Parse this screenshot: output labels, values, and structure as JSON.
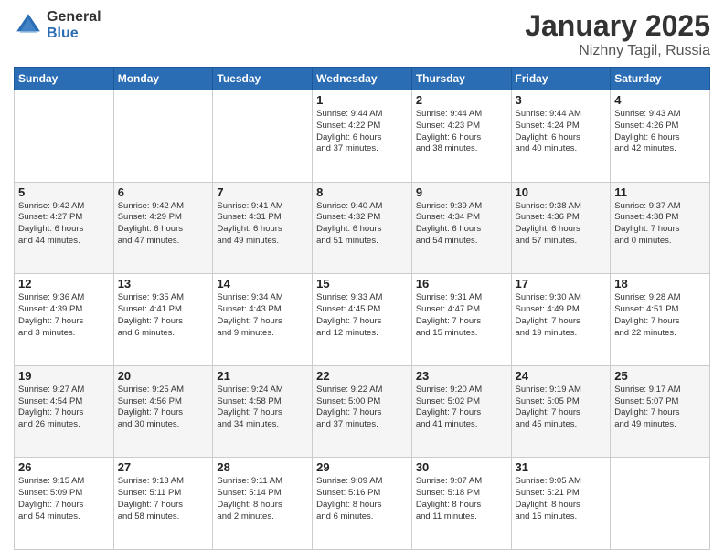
{
  "logo": {
    "general": "General",
    "blue": "Blue"
  },
  "header": {
    "month": "January 2025",
    "location": "Nizhny Tagil, Russia"
  },
  "weekdays": [
    "Sunday",
    "Monday",
    "Tuesday",
    "Wednesday",
    "Thursday",
    "Friday",
    "Saturday"
  ],
  "weeks": [
    [
      {
        "day": "",
        "info": ""
      },
      {
        "day": "",
        "info": ""
      },
      {
        "day": "",
        "info": ""
      },
      {
        "day": "1",
        "info": "Sunrise: 9:44 AM\nSunset: 4:22 PM\nDaylight: 6 hours\nand 37 minutes."
      },
      {
        "day": "2",
        "info": "Sunrise: 9:44 AM\nSunset: 4:23 PM\nDaylight: 6 hours\nand 38 minutes."
      },
      {
        "day": "3",
        "info": "Sunrise: 9:44 AM\nSunset: 4:24 PM\nDaylight: 6 hours\nand 40 minutes."
      },
      {
        "day": "4",
        "info": "Sunrise: 9:43 AM\nSunset: 4:26 PM\nDaylight: 6 hours\nand 42 minutes."
      }
    ],
    [
      {
        "day": "5",
        "info": "Sunrise: 9:42 AM\nSunset: 4:27 PM\nDaylight: 6 hours\nand 44 minutes."
      },
      {
        "day": "6",
        "info": "Sunrise: 9:42 AM\nSunset: 4:29 PM\nDaylight: 6 hours\nand 47 minutes."
      },
      {
        "day": "7",
        "info": "Sunrise: 9:41 AM\nSunset: 4:31 PM\nDaylight: 6 hours\nand 49 minutes."
      },
      {
        "day": "8",
        "info": "Sunrise: 9:40 AM\nSunset: 4:32 PM\nDaylight: 6 hours\nand 51 minutes."
      },
      {
        "day": "9",
        "info": "Sunrise: 9:39 AM\nSunset: 4:34 PM\nDaylight: 6 hours\nand 54 minutes."
      },
      {
        "day": "10",
        "info": "Sunrise: 9:38 AM\nSunset: 4:36 PM\nDaylight: 6 hours\nand 57 minutes."
      },
      {
        "day": "11",
        "info": "Sunrise: 9:37 AM\nSunset: 4:38 PM\nDaylight: 7 hours\nand 0 minutes."
      }
    ],
    [
      {
        "day": "12",
        "info": "Sunrise: 9:36 AM\nSunset: 4:39 PM\nDaylight: 7 hours\nand 3 minutes."
      },
      {
        "day": "13",
        "info": "Sunrise: 9:35 AM\nSunset: 4:41 PM\nDaylight: 7 hours\nand 6 minutes."
      },
      {
        "day": "14",
        "info": "Sunrise: 9:34 AM\nSunset: 4:43 PM\nDaylight: 7 hours\nand 9 minutes."
      },
      {
        "day": "15",
        "info": "Sunrise: 9:33 AM\nSunset: 4:45 PM\nDaylight: 7 hours\nand 12 minutes."
      },
      {
        "day": "16",
        "info": "Sunrise: 9:31 AM\nSunset: 4:47 PM\nDaylight: 7 hours\nand 15 minutes."
      },
      {
        "day": "17",
        "info": "Sunrise: 9:30 AM\nSunset: 4:49 PM\nDaylight: 7 hours\nand 19 minutes."
      },
      {
        "day": "18",
        "info": "Sunrise: 9:28 AM\nSunset: 4:51 PM\nDaylight: 7 hours\nand 22 minutes."
      }
    ],
    [
      {
        "day": "19",
        "info": "Sunrise: 9:27 AM\nSunset: 4:54 PM\nDaylight: 7 hours\nand 26 minutes."
      },
      {
        "day": "20",
        "info": "Sunrise: 9:25 AM\nSunset: 4:56 PM\nDaylight: 7 hours\nand 30 minutes."
      },
      {
        "day": "21",
        "info": "Sunrise: 9:24 AM\nSunset: 4:58 PM\nDaylight: 7 hours\nand 34 minutes."
      },
      {
        "day": "22",
        "info": "Sunrise: 9:22 AM\nSunset: 5:00 PM\nDaylight: 7 hours\nand 37 minutes."
      },
      {
        "day": "23",
        "info": "Sunrise: 9:20 AM\nSunset: 5:02 PM\nDaylight: 7 hours\nand 41 minutes."
      },
      {
        "day": "24",
        "info": "Sunrise: 9:19 AM\nSunset: 5:05 PM\nDaylight: 7 hours\nand 45 minutes."
      },
      {
        "day": "25",
        "info": "Sunrise: 9:17 AM\nSunset: 5:07 PM\nDaylight: 7 hours\nand 49 minutes."
      }
    ],
    [
      {
        "day": "26",
        "info": "Sunrise: 9:15 AM\nSunset: 5:09 PM\nDaylight: 7 hours\nand 54 minutes."
      },
      {
        "day": "27",
        "info": "Sunrise: 9:13 AM\nSunset: 5:11 PM\nDaylight: 7 hours\nand 58 minutes."
      },
      {
        "day": "28",
        "info": "Sunrise: 9:11 AM\nSunset: 5:14 PM\nDaylight: 8 hours\nand 2 minutes."
      },
      {
        "day": "29",
        "info": "Sunrise: 9:09 AM\nSunset: 5:16 PM\nDaylight: 8 hours\nand 6 minutes."
      },
      {
        "day": "30",
        "info": "Sunrise: 9:07 AM\nSunset: 5:18 PM\nDaylight: 8 hours\nand 11 minutes."
      },
      {
        "day": "31",
        "info": "Sunrise: 9:05 AM\nSunset: 5:21 PM\nDaylight: 8 hours\nand 15 minutes."
      },
      {
        "day": "",
        "info": ""
      }
    ]
  ]
}
